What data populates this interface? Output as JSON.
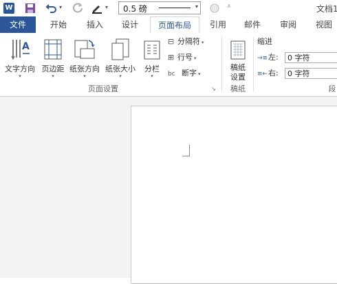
{
  "qat": {
    "word_logo": "W",
    "line_weight": "0.5 磅",
    "title": "文档1"
  },
  "tabs": [
    {
      "label": "文件"
    },
    {
      "label": "开始"
    },
    {
      "label": "插入"
    },
    {
      "label": "设计"
    },
    {
      "label": "页面布局"
    },
    {
      "label": "引用"
    },
    {
      "label": "邮件"
    },
    {
      "label": "审阅"
    },
    {
      "label": "视图"
    }
  ],
  "ribbon": {
    "text_direction": "文字方向",
    "margins": "页边距",
    "orientation": "纸张方向",
    "size": "纸张大小",
    "columns": "分栏",
    "breaks": "分隔符",
    "line_numbers": "行号",
    "hyphenation": "断字",
    "page_setup_group": "页面设置",
    "draft_settings": "稿纸",
    "draft_settings_2": "设置",
    "draft_group": "稿纸",
    "indent_title": "缩进",
    "indent_left_label": "左:",
    "indent_left_value": "0 字符",
    "indent_right_label": "右:",
    "indent_right_value": "0 字符",
    "spacing_group_partial": "段"
  },
  "colors": {
    "accent": "#2b579a",
    "doc_background": "#f3f3f3"
  }
}
